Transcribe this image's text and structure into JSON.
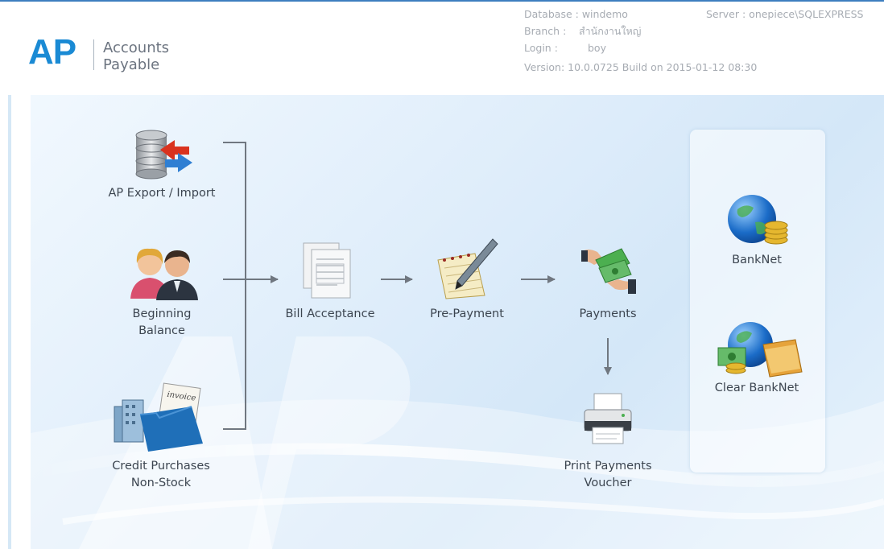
{
  "header": {
    "logo_text": "AP",
    "logo_line1": "Accounts",
    "logo_line2": "Payable",
    "database_label": "Database :",
    "database_value": "windemo",
    "server_label": "Server :",
    "server_value": "onepiece\\SQLEXPRESS",
    "branch_label": "Branch :",
    "branch_value": "สำนักงานใหญ่",
    "login_label": "Login :",
    "login_value": "boy",
    "version_text": "Version: 10.0.0725  Build on 2015-01-12 08:30"
  },
  "background": {
    "watermark_text": "AP"
  },
  "nodes": {
    "ap_export_import": {
      "label": "AP Export / Import",
      "icon": "database-import-export-icon"
    },
    "beginning_balance": {
      "line1": "Beginning",
      "line2": "Balance",
      "icon": "users-icon"
    },
    "credit_purchases": {
      "line1": "Credit Purchases",
      "line2": "Non-Stock",
      "icon": "invoice-folder-icon"
    },
    "bill_acceptance": {
      "label": "Bill Acceptance",
      "icon": "documents-icon"
    },
    "pre_payment": {
      "label": "Pre-Payment",
      "icon": "notepad-pen-icon"
    },
    "payments": {
      "label": "Payments",
      "icon": "cash-hands-icon"
    },
    "print_voucher": {
      "line1": "Print Payments",
      "line2": "Voucher",
      "icon": "printer-icon"
    },
    "banknet": {
      "label": "BankNet",
      "icon": "globe-coins-icon"
    },
    "clear_banknet": {
      "label": "Clear BankNet",
      "icon": "globe-money-folder-icon"
    }
  },
  "colors": {
    "logo_blue": "#1a8ad4",
    "header_text": "#a7acb3",
    "label_text": "#3c4550",
    "connector": "#707780"
  }
}
